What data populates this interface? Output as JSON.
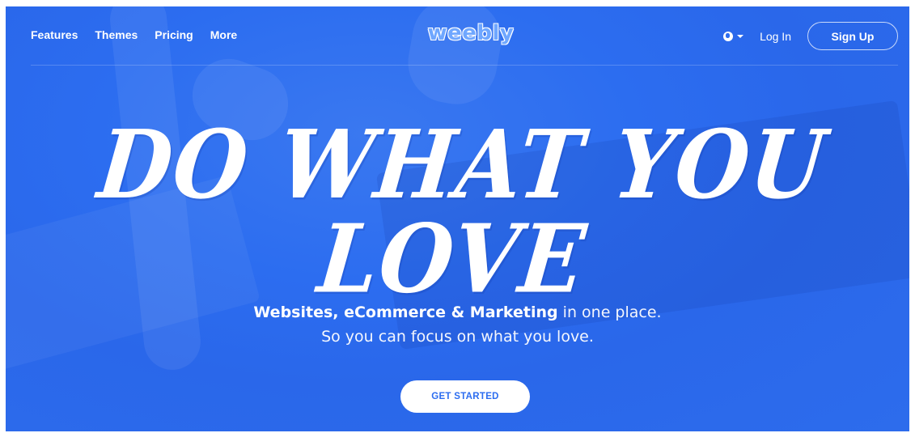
{
  "nav": {
    "links": [
      "Features",
      "Themes",
      "Pricing",
      "More"
    ],
    "logo": "weebly",
    "login_label": "Log In",
    "signup_label": "Sign Up"
  },
  "hero": {
    "headline": "DO WHAT YOU LOVE",
    "subline_bold": "Websites, eCommerce & Marketing",
    "subline_rest": " in one place.",
    "subline_2": "So you can focus on what you love.",
    "cta_label": "GET STARTED"
  },
  "colors": {
    "hero_blue": "#2c6df0",
    "text": "#ffffff"
  },
  "icons": [
    "globe-icon",
    "caret-down-icon"
  ]
}
